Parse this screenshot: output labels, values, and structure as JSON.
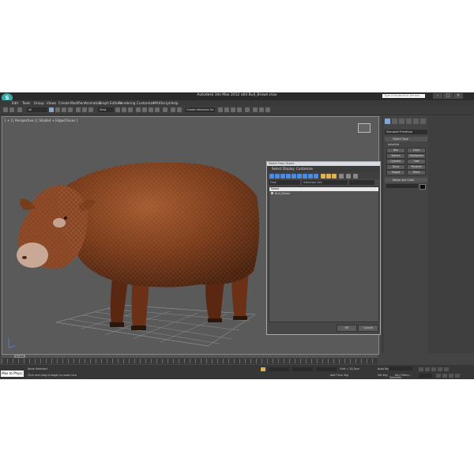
{
  "window": {
    "title": "Autodesk 3ds Max 2012 x64     Bull_Brown.max",
    "search_placeholder": "Type a keyword or phrase"
  },
  "menubar": [
    "Edit",
    "Tools",
    "Group",
    "Views",
    "Create",
    "Modifiers",
    "Animation",
    "Graph Editors",
    "Rendering",
    "Customize",
    "MAXScript",
    "Help"
  ],
  "toolbar": {
    "filter": "All",
    "view_dropdown": "View",
    "selection_set": "Create Selection Se"
  },
  "viewport": {
    "label": "[ + ] [ Perspective ] [ Shaded + Edged Faces ]"
  },
  "dialog": {
    "title": "Select From Scene",
    "menu": [
      "Select",
      "Display",
      "Customize"
    ],
    "find_label": "Find:",
    "selection_set_label": "Selection Set:",
    "column_header": "Name",
    "items": [
      "Bull_Brown"
    ],
    "ok": "OK",
    "cancel": "Cancel"
  },
  "command_panel": {
    "category_dropdown": "Standard Primitives",
    "object_type_header": "Object Type",
    "autogrid_label": "AutoGrid",
    "object_buttons": [
      "Box",
      "Cone",
      "Sphere",
      "GeoSphere",
      "Cylinder",
      "Tube",
      "Torus",
      "Pyramid",
      "Teapot",
      "Plane"
    ],
    "name_color_header": "Name and Color",
    "color": "#0b0b0b"
  },
  "timeline": {
    "frame_display": "0 / 100",
    "ticks": [
      "0",
      "5",
      "10",
      "15",
      "20",
      "25",
      "30",
      "35",
      "40",
      "45",
      "50",
      "55",
      "60",
      "65",
      "70",
      "75",
      "80",
      "85",
      "90",
      "95",
      "100"
    ]
  },
  "status_bar": {
    "maxscript_button": "Max to Physc",
    "selection_status": "None Selected",
    "prompt": "Click and drag to begin to zoom into",
    "grid": "Grid = 10,0cm",
    "auto_key": "Auto Key",
    "set_key": "Set Key",
    "selected": "Selected",
    "key_filters": "Key Filters...",
    "add_time_tag": "Add Time Tag"
  }
}
